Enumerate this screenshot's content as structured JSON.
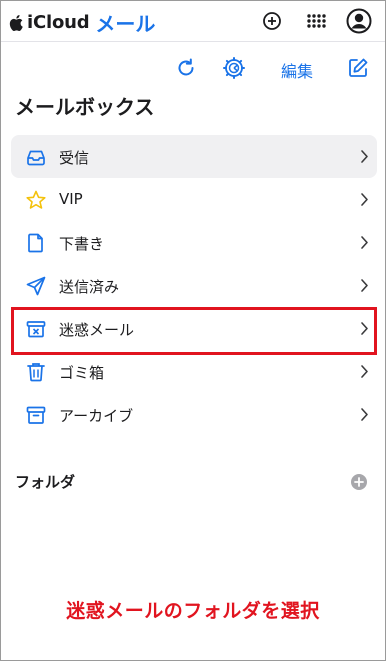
{
  "header": {
    "brand_icloud": "iCloud",
    "brand_mail": "メール"
  },
  "toolbar": {
    "edit_label": "編集"
  },
  "mailbox_title": "メールボックス",
  "mailboxes": [
    {
      "label": "受信",
      "icon": "inbox-icon",
      "selected": true
    },
    {
      "label": "VIP",
      "icon": "star-icon"
    },
    {
      "label": "下書き",
      "icon": "document-icon"
    },
    {
      "label": "送信済み",
      "icon": "paper-plane-icon"
    },
    {
      "label": "迷惑メール",
      "icon": "junk-box-icon"
    },
    {
      "label": "ゴミ箱",
      "icon": "trash-icon"
    },
    {
      "label": "アーカイブ",
      "icon": "archive-icon"
    }
  ],
  "folders": {
    "title": "フォルダ"
  },
  "caption": "迷惑メールのフォルダを選択",
  "colors": {
    "accent": "#1a73e8",
    "highlight": "#e1141f",
    "selected_bg": "#f0f0f2",
    "star": "#f4c20d"
  }
}
